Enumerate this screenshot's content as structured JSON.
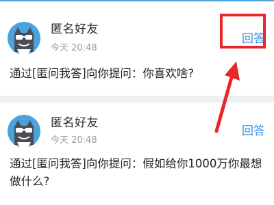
{
  "messages": [
    {
      "sender": "匿名好友",
      "time": "今天 20:48",
      "question": "通过[匿问我答]向你提问：你喜欢啥?",
      "action_label": "回答"
    },
    {
      "sender": "匿名好友",
      "time": "今天 20:48",
      "question": "通过[匿问我答]向你提问：假如给你1000万你最想做什么?",
      "action_label": "回答"
    }
  ],
  "colors": {
    "accent": "#3a8ee6",
    "highlight": "#e8262b",
    "avatar_bg": "#4aa3df",
    "background": "#eef0f3"
  },
  "icons": {
    "avatar": "anonymous-cat-mask-avatar-icon",
    "annotation": "red-arrow-icon"
  }
}
